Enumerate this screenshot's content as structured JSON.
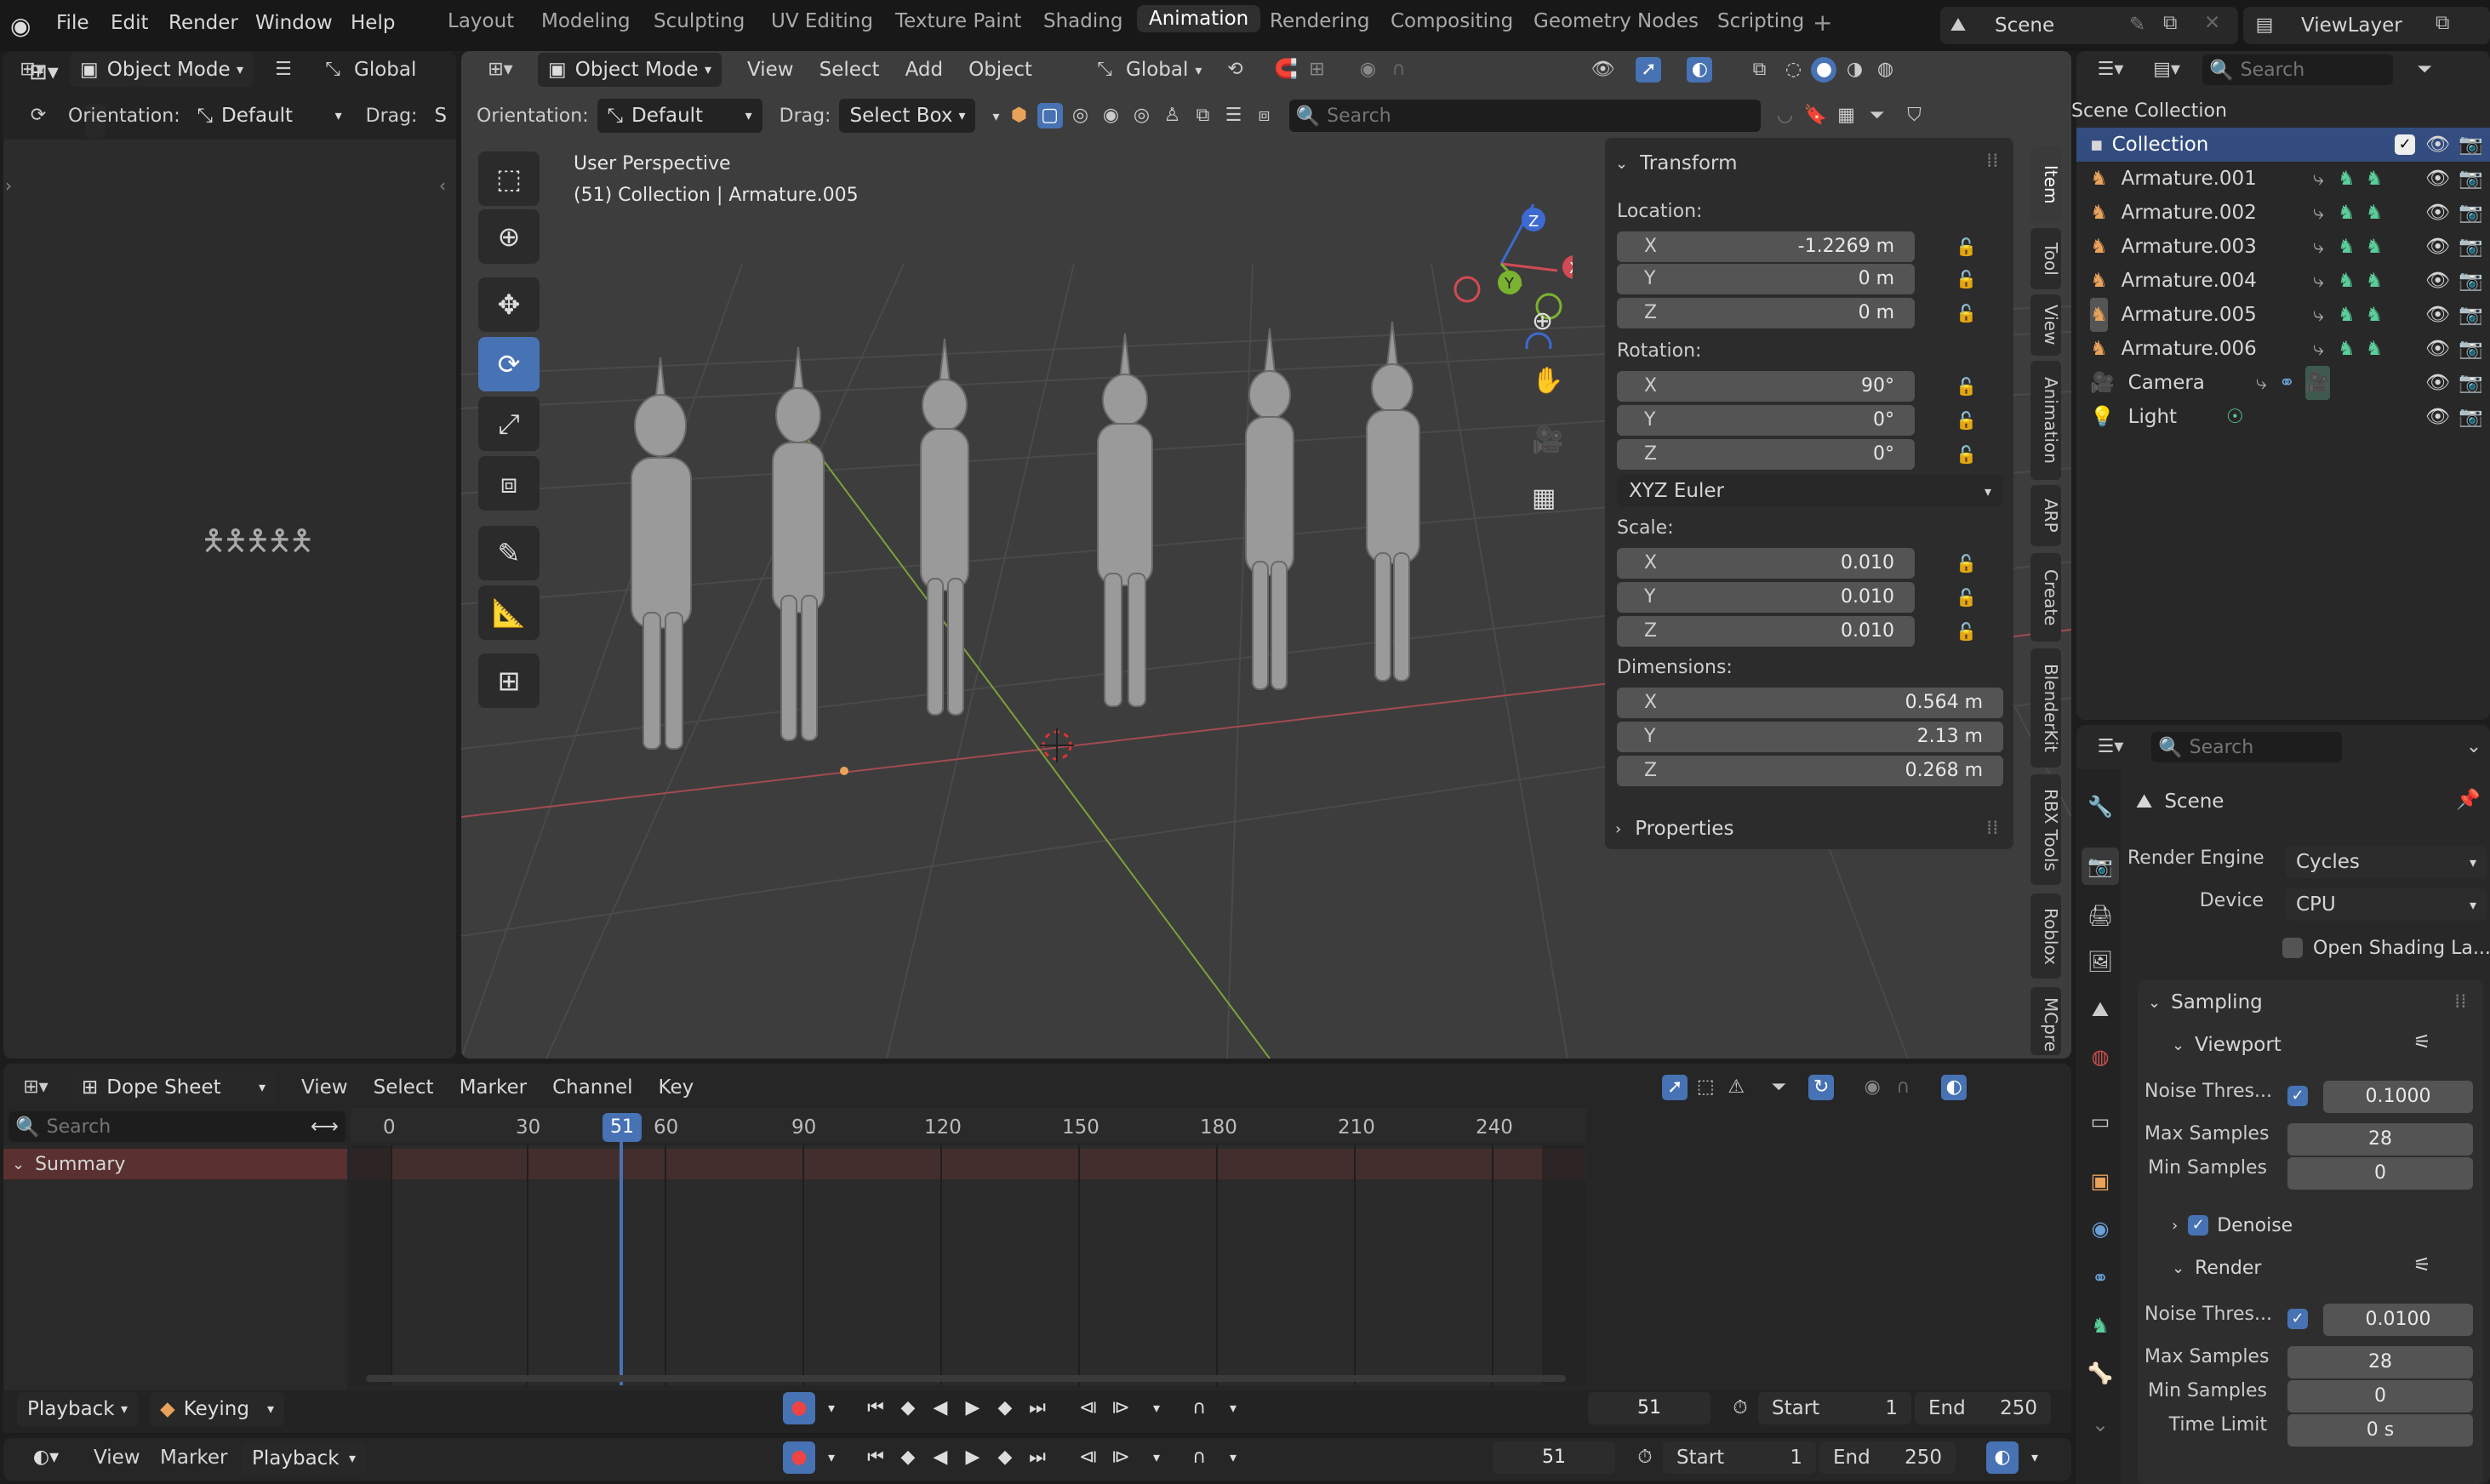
{
  "menubar": {
    "items": [
      "File",
      "Edit",
      "Render",
      "Window",
      "Help"
    ],
    "workspaces": [
      "Layout",
      "Modeling",
      "Sculpting",
      "UV Editing",
      "Texture Paint",
      "Shading",
      "Animation",
      "Rendering",
      "Compositing",
      "Geometry Nodes",
      "Scripting"
    ],
    "active_workspace": "Animation",
    "scene": "Scene",
    "view_layer": "ViewLayer"
  },
  "left_area": {
    "mode": "Object Mode",
    "transform": "Global",
    "orientation_label": "Orientation:",
    "orientation_value": "Default",
    "drag_label": "Drag:",
    "drag_value": "S"
  },
  "viewport": {
    "mode": "Object Mode",
    "menus": [
      "View",
      "Select",
      "Add",
      "Object"
    ],
    "transform": "Global",
    "orientation_label": "Orientation:",
    "orientation_value": "Default",
    "drag_label": "Drag:",
    "drag_value": "Select Box",
    "search_placeholder": "Search",
    "overlay_title": "User Perspective",
    "overlay_sub": "(51) Collection | Armature.005"
  },
  "npanel": {
    "transform_title": "Transform",
    "location_label": "Location:",
    "location": {
      "x": "-1.2269 m",
      "y": "0 m",
      "z": "0 m"
    },
    "rotation_label": "Rotation:",
    "rotation": {
      "x": "90°",
      "y": "0°",
      "z": "0°"
    },
    "rotation_mode": "XYZ Euler",
    "scale_label": "Scale:",
    "scale": {
      "x": "0.010",
      "y": "0.010",
      "z": "0.010"
    },
    "dimensions_label": "Dimensions:",
    "dimensions": {
      "x": "0.564 m",
      "y": "2.13 m",
      "z": "0.268 m"
    },
    "properties_title": "Properties",
    "axis": {
      "x": "X",
      "y": "Y",
      "z": "Z"
    },
    "tabs": [
      "Item",
      "Tool",
      "View",
      "Animation",
      "ARP",
      "Create",
      "BlenderKit",
      "RBX Tools",
      "Roblox",
      "MCpre"
    ]
  },
  "outliner": {
    "search_placeholder": "Search",
    "scene_collection": "Scene Collection",
    "collection": "Collection",
    "items": [
      "Armature.001",
      "Armature.002",
      "Armature.003",
      "Armature.004",
      "Armature.005",
      "Armature.006",
      "Camera",
      "Light"
    ]
  },
  "properties": {
    "search_placeholder": "Search",
    "scene": "Scene",
    "render_engine_label": "Render Engine",
    "render_engine": "Cycles",
    "device_label": "Device",
    "device": "CPU",
    "open_shading": "Open Shading La...",
    "sampling": "Sampling",
    "viewport": "Viewport",
    "noise_label": "Noise Thres...",
    "vp_noise": "0.1000",
    "max_samples_label": "Max Samples",
    "vp_max": "28",
    "min_samples_label": "Min Samples",
    "vp_min": "0",
    "denoise": "Denoise",
    "render": "Render",
    "r_noise": "0.0100",
    "r_max": "28",
    "r_min": "0",
    "time_limit_label": "Time Limit",
    "time_limit": "0 s"
  },
  "dopesheet": {
    "editor": "Dope Sheet",
    "menus": [
      "View",
      "Select",
      "Marker",
      "Channel",
      "Key"
    ],
    "search_placeholder": "Search",
    "summary": "Summary",
    "ticks": [
      "0",
      "30",
      "60",
      "90",
      "120",
      "150",
      "180",
      "210",
      "240"
    ],
    "current_frame": "51",
    "playback": "Playback",
    "keying": "Keying",
    "frame": "51",
    "start_label": "Start",
    "start": "1",
    "end_label": "End",
    "end": "250"
  },
  "timeline": {
    "menus": [
      "View",
      "Marker",
      "Playback"
    ],
    "frame": "51",
    "start_label": "Start",
    "start": "1",
    "end_label": "End",
    "end": "250"
  },
  "colors": {
    "accent": "#4772b3",
    "green": "#5bcf9a",
    "orange": "#e8a25a"
  }
}
